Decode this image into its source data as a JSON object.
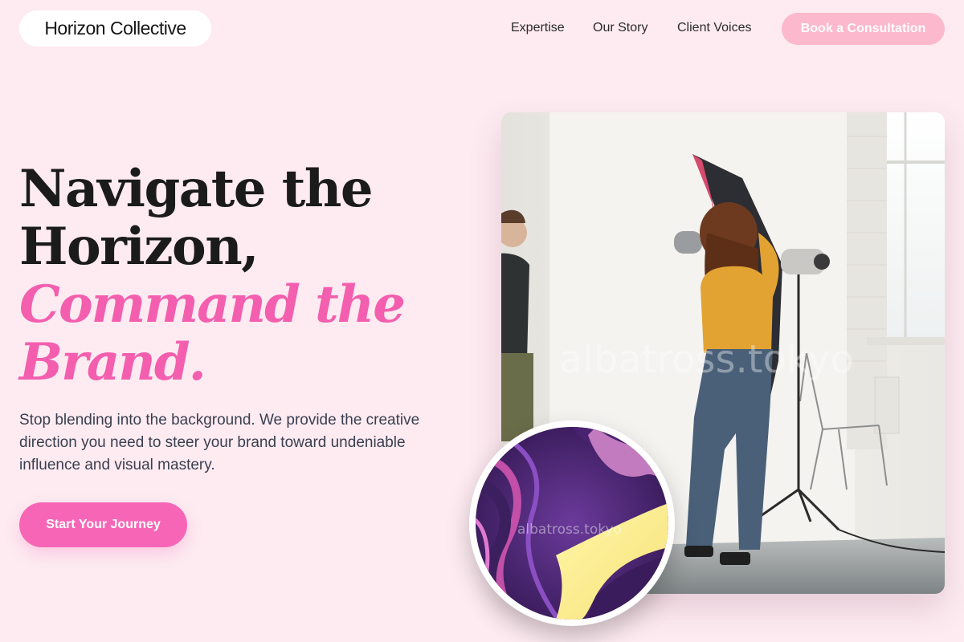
{
  "brand": {
    "name": "Horizon Collective"
  },
  "nav": {
    "links": [
      "Expertise",
      "Our Story",
      "Client Voices"
    ],
    "cta_label": "Book a Consultation"
  },
  "hero": {
    "title_line1": "Navigate the",
    "title_line2": "Horizon,",
    "title_accent_line1": "Command the",
    "title_accent_line2": "Brand.",
    "subtitle": "Stop blending into the background. We provide the creative direction you need to steer your brand toward undeniable influence and visual mastery.",
    "cta_label": "Start Your Journey"
  },
  "media": {
    "watermark": "albatross.tokyo",
    "circle_watermark": "albatross.tokyo"
  },
  "colors": {
    "background": "#fdebf1",
    "accent_pink": "#f35fae",
    "cta_pink": "#f766b6",
    "cta_light_pink": "#fcb8cc",
    "text_dark": "#1b1b1b",
    "text_body": "#3a3f4f"
  }
}
